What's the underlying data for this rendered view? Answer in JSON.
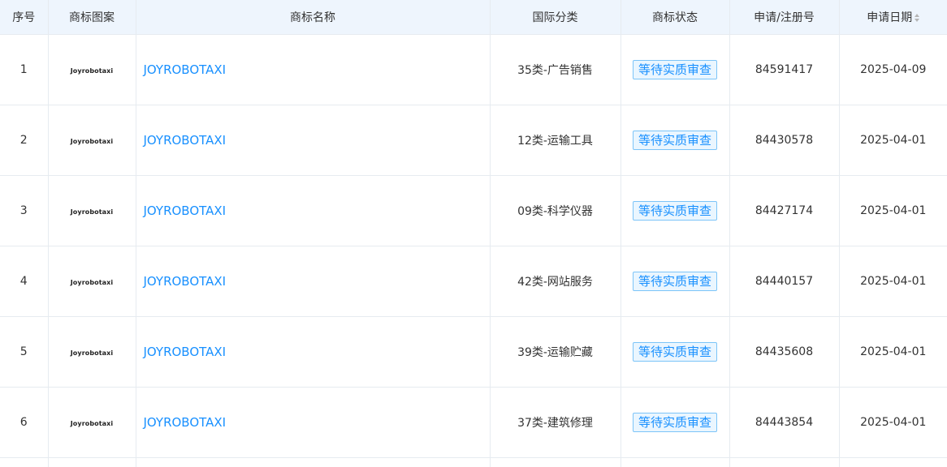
{
  "table": {
    "headers": {
      "index": "序号",
      "logo": "商标图案",
      "name": "商标名称",
      "class": "国际分类",
      "status": "商标状态",
      "reg_no": "申请/注册号",
      "date": "申请日期"
    },
    "rows": [
      {
        "index": "1",
        "logo": "Joyrobotaxi",
        "name": "JOYROBOTAXI",
        "class": "35类-广告销售",
        "status": "等待实质审查",
        "reg_no": "84591417",
        "date": "2025-04-09"
      },
      {
        "index": "2",
        "logo": "Joyrobotaxi",
        "name": "JOYROBOTAXI",
        "class": "12类-运输工具",
        "status": "等待实质审查",
        "reg_no": "84430578",
        "date": "2025-04-01"
      },
      {
        "index": "3",
        "logo": "Joyrobotaxi",
        "name": "JOYROBOTAXI",
        "class": "09类-科学仪器",
        "status": "等待实质审查",
        "reg_no": "84427174",
        "date": "2025-04-01"
      },
      {
        "index": "4",
        "logo": "Joyrobotaxi",
        "name": "JOYROBOTAXI",
        "class": "42类-网站服务",
        "status": "等待实质审查",
        "reg_no": "84440157",
        "date": "2025-04-01"
      },
      {
        "index": "5",
        "logo": "Joyrobotaxi",
        "name": "JOYROBOTAXI",
        "class": "39类-运输贮藏",
        "status": "等待实质审查",
        "reg_no": "84435608",
        "date": "2025-04-01"
      },
      {
        "index": "6",
        "logo": "Joyrobotaxi",
        "name": "JOYROBOTAXI",
        "class": "37类-建筑修理",
        "status": "等待实质审查",
        "reg_no": "84443854",
        "date": "2025-04-01"
      }
    ]
  },
  "colors": {
    "header_bg": "#eef5fd",
    "link": "#1890ff",
    "badge_border": "#7cc4f8",
    "badge_bg": "#eaf6ff",
    "border": "#e6ebf0"
  },
  "icons": {
    "sort": "sort-icon"
  }
}
